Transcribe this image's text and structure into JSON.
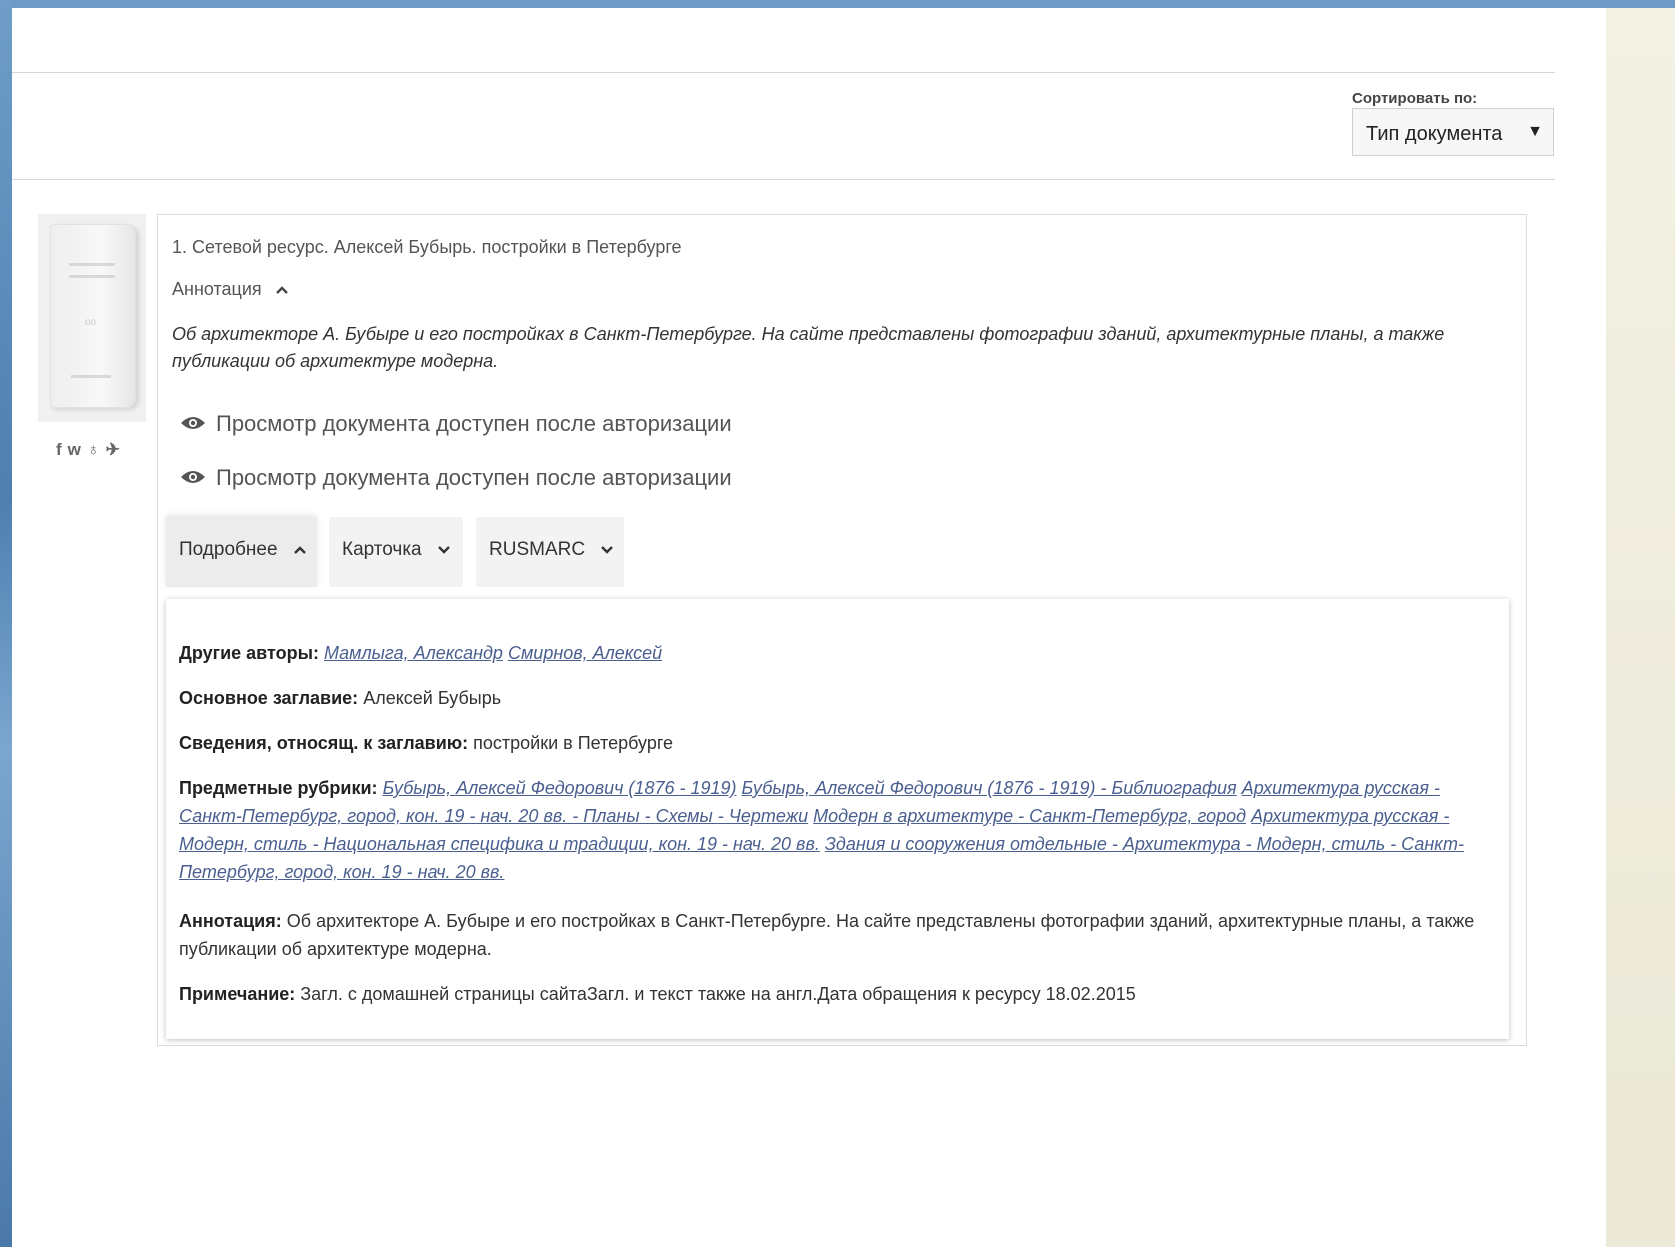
{
  "sort": {
    "label": "Сортировать по:",
    "value": "Тип документа",
    "arrow": "▼"
  },
  "socials": [
    "f",
    "vk",
    "ok",
    "tw"
  ],
  "socials_glyphs": {
    "f": "f",
    "vk": "w",
    "ok": "♁",
    "tw": "✈"
  },
  "record": {
    "title": "1. Сетевой ресурс. Алексей Бубырь. постройки в Петербурге",
    "annotation_toggle": "Аннотация",
    "annotation_text": "Об архитекторе А. Бубыре и его постройках в Санкт-Петербурге. На сайте представлены фотографии зданий, архитектурные планы, а также публикации об архитектуре модерна.",
    "view_links": [
      "Просмотр документа доступен после авторизации",
      "Просмотр документа доступен после авторизации"
    ],
    "tabs": [
      {
        "label": "Подробнее",
        "chevron": "up"
      },
      {
        "label": "Карточка",
        "chevron": "down"
      },
      {
        "label": "RUSMARC",
        "chevron": "down"
      }
    ]
  },
  "details": {
    "other_authors": {
      "label": "Другие авторы:",
      "links": [
        "Мамлыга, Александр",
        "Смирнов, Алексей"
      ]
    },
    "main_title": {
      "label": "Основное заглавие:",
      "value": "Алексей Бубырь"
    },
    "title_info": {
      "label": "Сведения, относящ. к заглавию:",
      "value": "постройки в Петербурге"
    },
    "subjects": {
      "label": "Предметные рубрики:",
      "links": [
        "Бубырь, Алексей Федорович (1876 - 1919)",
        "Бубырь, Алексей Федорович (1876 - 1919) - Библиография",
        "Архитектура русская - Санкт-Петербург, город, кон. 19 - нач. 20 вв. - Планы - Схемы - Чертежи",
        "Модерн в архитектуре - Санкт-Петербург, город",
        "Архитектура русская - Модерн, стиль - Национальная специфика и традиции, кон. 19 - нач. 20 вв.",
        "Здания и сооружения отдельные - Архитектура - Модерн, стиль - Санкт-Петербург, город, кон. 19 - нач. 20 вв."
      ]
    },
    "annotation": {
      "label": "Аннотация:",
      "value": "Об архитекторе А. Бубыре и его постройках в Санкт-Петербурге. На сайте представлены фотографии зданий, архитектурные планы, а также публикации об архитектуре модерна."
    },
    "note": {
      "label": "Примечание:",
      "value": "Загл. с домашней страницы сайтаЗагл. и текст также на англ.Дата обращения к ресурсу 18.02.2015"
    }
  }
}
